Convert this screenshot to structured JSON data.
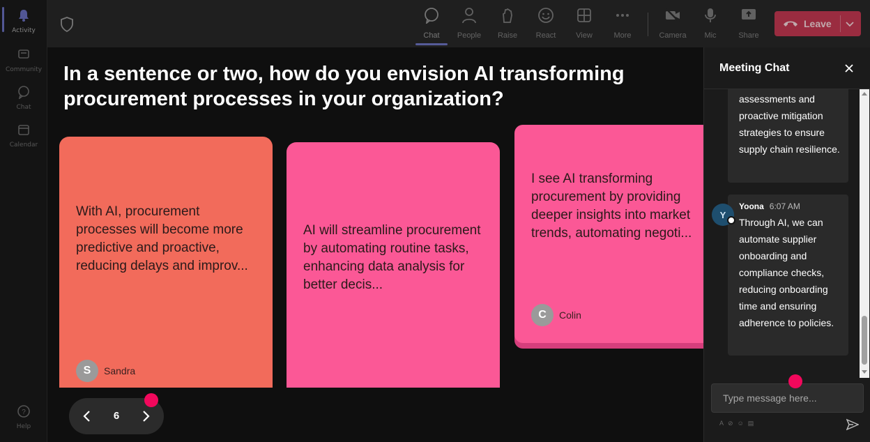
{
  "rail": {
    "items": [
      {
        "label": "Activity",
        "icon": "bell-icon"
      },
      {
        "label": "Community",
        "icon": "community-icon"
      },
      {
        "label": "Chat",
        "icon": "chat-icon"
      },
      {
        "label": "Calendar",
        "icon": "calendar-icon"
      },
      {
        "label": "Help",
        "icon": "help-icon"
      }
    ]
  },
  "toolbar": {
    "chat": "Chat",
    "people": "People",
    "raise": "Raise",
    "react": "React",
    "view": "View",
    "more": "More",
    "camera": "Camera",
    "mic": "Mic",
    "share": "Share",
    "leave": "Leave"
  },
  "stage": {
    "question": "In a sentence or two, how do you envision AI transforming procurement processes in your organization?",
    "cards": [
      {
        "text": "With AI, procurement processes will become more predictive and proactive, reducing delays and improv...",
        "initial": "S",
        "author": "Sandra",
        "color": "#f26b5b"
      },
      {
        "text": "AI will streamline procurement by automating routine tasks, enhancing data analysis for better decis...",
        "color": "#fb5896"
      },
      {
        "text": "I see AI transforming procurement by providing deeper insights into market trends, automating negoti...",
        "initial": "C",
        "author": "Colin",
        "color": "#fb5896"
      }
    ],
    "page": "6"
  },
  "chat": {
    "title": "Meeting Chat",
    "messages": [
      {
        "text": "assessments and proactive mitigation strategies to ensure supply chain resilience."
      },
      {
        "initial": "Y",
        "author": "Yoona",
        "time": "6:07 AM",
        "text": "Through AI, we can automate supplier onboarding and compliance checks, reducing onboarding time and ensuring adherence to policies."
      }
    ],
    "input_placeholder": "Type message here..."
  },
  "colors": {
    "accent": "#7b83eb",
    "leave": "#c4314b",
    "highlight_dot": "#f2085c"
  }
}
